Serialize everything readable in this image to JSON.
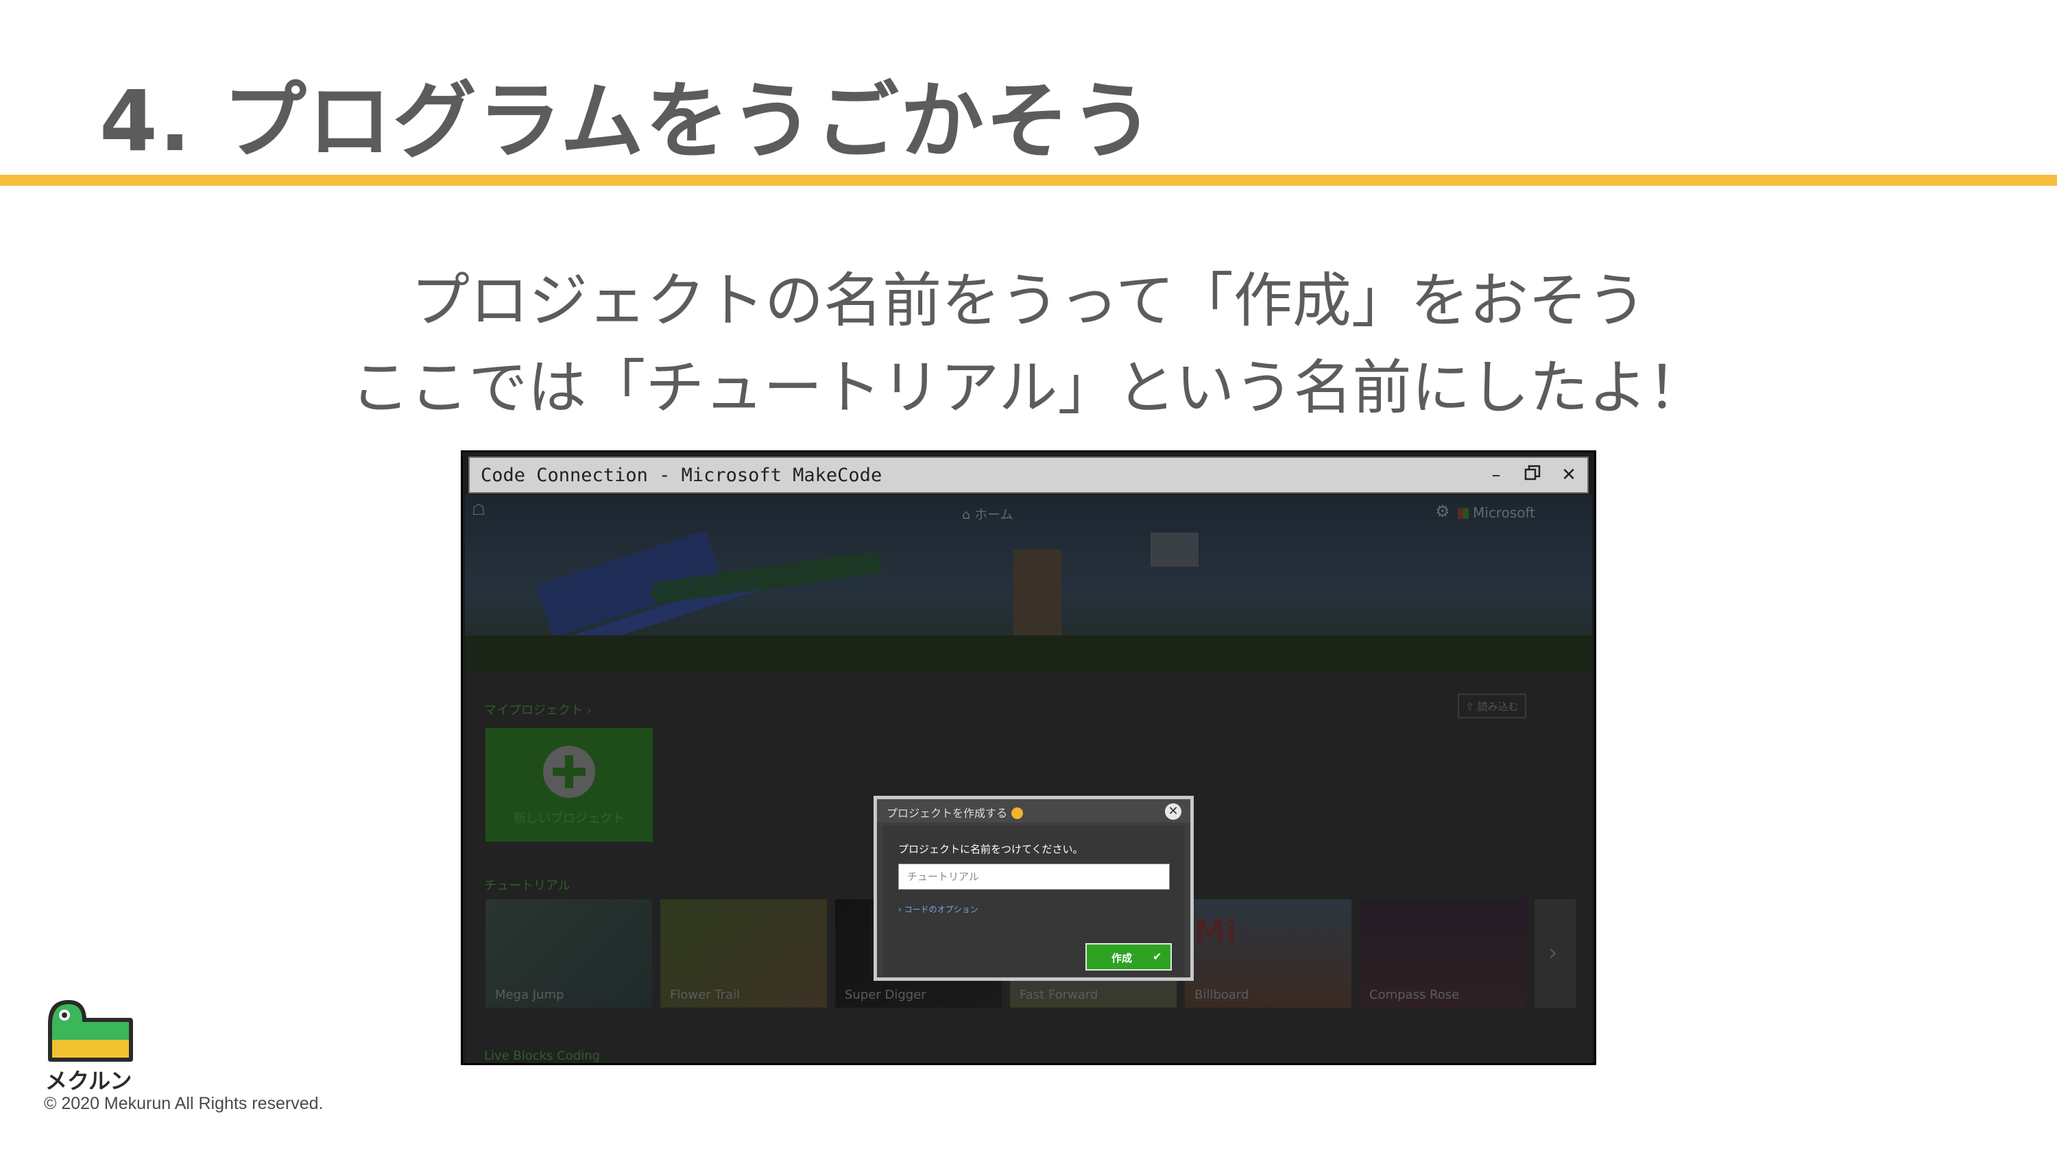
{
  "slide": {
    "title": "4. プログラムをうごかそう",
    "line1": "プロジェクトの名前をうって「作成」をおそう",
    "line2": "ここでは「チュートリアル」という名前にしたよ！",
    "accent_color": "#f6bf3b"
  },
  "window": {
    "title": "Code Connection - Microsoft MakeCode",
    "minimize_icon": "minimize-icon",
    "restore_icon": "restore-icon",
    "close_icon": "close-icon"
  },
  "app": {
    "home_label": "ホーム",
    "microsoft_label": "Microsoft",
    "my_projects_label": "マイプロジェクト ›",
    "import_label": "読み込む",
    "new_project_label": "新しいプロジェクト",
    "tutorials_label": "チュートリアル",
    "tutorials": [
      "Mega Jump",
      "Flower Trail",
      "Super Digger",
      "Fast Forward",
      "Billboard",
      "Compass Rose"
    ],
    "live_label": "Live Blocks Coding"
  },
  "dialog": {
    "title": "プロジェクトを作成する",
    "prompt": "プロジェクトに名前をつけてください。",
    "input_value": "チュートリアル",
    "code_options": "› コードのオプション",
    "create_label": "作成",
    "create_check": "✔",
    "close_glyph": "✕"
  },
  "footer": {
    "logo_text": "メクルン",
    "copyright": "© 2020 Mekurun All Rights reserved."
  }
}
